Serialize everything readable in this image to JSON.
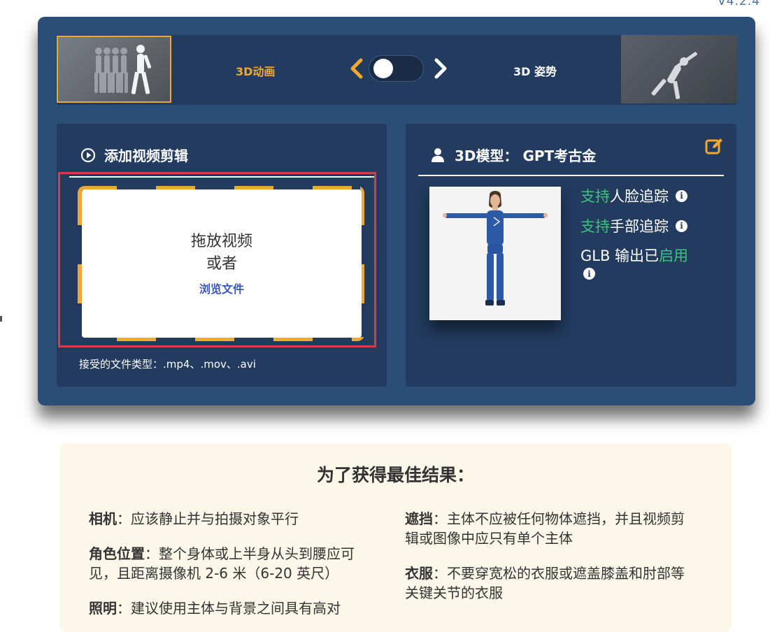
{
  "version": "V4.2.4",
  "mode_switch": {
    "animation_label": "3D动画",
    "pose_label": "3D 姿势"
  },
  "upload_card": {
    "title": "添加视频剪辑",
    "drop_line1": "拖放视频",
    "drop_line2": "或者",
    "browse_label": "浏览文件",
    "accepted_types": "接受的文件类型：.mp4、.mov、.avi"
  },
  "model_card": {
    "title": "3D模型： GPT考古金",
    "features": [
      {
        "highlight": "支持",
        "text": " 人脸追踪"
      },
      {
        "highlight": "支持",
        "text": " 手部追踪"
      },
      {
        "prefix": "GLB 输出已",
        "highlight": "启用"
      }
    ]
  },
  "tips": {
    "title": "为了获得最佳结果：",
    "items": [
      {
        "label": "相机",
        "text": "：应该静止并与拍摄对象平行"
      },
      {
        "label": "角色位置",
        "text": "：整个身体或上半身从头到腰应可见，且距离摄像机 2-6 米（6-20 英尺）"
      },
      {
        "label": "照明",
        "text": "：建议使用主体与背景之间具有高对"
      },
      {
        "label": "遮挡",
        "text": "：主体不应被任何物体遮挡，并且视频剪辑或图像中应只有单个主体"
      },
      {
        "label": "衣服",
        "text": "：不要穿宽松的衣服或遮盖膝盖和肘部等关键关节的衣服"
      }
    ]
  },
  "colors": {
    "panel": "#2c4d78",
    "card": "#223b5e",
    "accent": "#f0a830",
    "green": "#3ec37a",
    "link": "#3a56b8",
    "highlight_border": "#e03a3a"
  }
}
